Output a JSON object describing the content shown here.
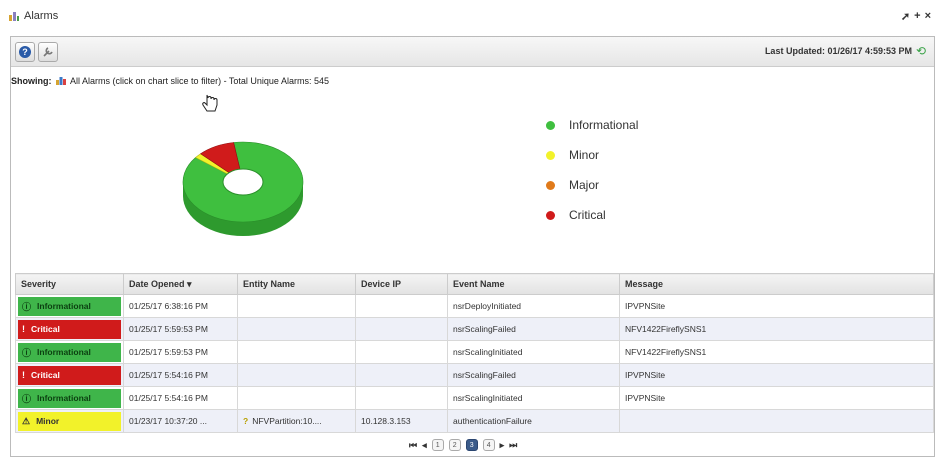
{
  "window": {
    "title": "Alarms",
    "controls": [
      "pin-icon",
      "add-icon",
      "close-icon"
    ]
  },
  "toolbar": {
    "help_icon": "help-icon",
    "settings_icon": "wrench-icon",
    "last_updated": "Last Updated: 01/26/17 4:59:53 PM",
    "refresh_icon": "refresh-icon"
  },
  "showing": {
    "label": "Showing:",
    "text": "All Alarms (click on chart slice to filter) - Total Unique Alarms: 545"
  },
  "chart_data": {
    "type": "pie",
    "categories": [
      "Informational",
      "Minor",
      "Major",
      "Critical"
    ],
    "colors": [
      "#3fbf3f",
      "#f2f22a",
      "#e07a1a",
      "#d01b1b"
    ],
    "values": [
      88,
      2,
      0,
      10
    ],
    "legend_position": "right",
    "donut": true
  },
  "grid": {
    "columns": [
      "Severity",
      "Date Opened",
      "Entity Name",
      "Device IP",
      "Event Name",
      "Message"
    ],
    "sort_indicator": "▾",
    "rows": [
      {
        "severity": "Informational",
        "sev_class": "sev-info",
        "sev_icon": "ⓘ",
        "date": "01/25/17 6:38:16 PM",
        "entity": "",
        "entity_icon": "",
        "ip": "",
        "event": "nsrDeployInitiated",
        "message": "IPVPNSite"
      },
      {
        "severity": "Critical",
        "sev_class": "sev-crit",
        "sev_icon": "!",
        "date": "01/25/17 5:59:53 PM",
        "entity": "",
        "entity_icon": "",
        "ip": "",
        "event": "nsrScalingFailed",
        "message": "NFV1422FireflySNS1"
      },
      {
        "severity": "Informational",
        "sev_class": "sev-info",
        "sev_icon": "ⓘ",
        "date": "01/25/17 5:59:53 PM",
        "entity": "",
        "entity_icon": "",
        "ip": "",
        "event": "nsrScalingInitiated",
        "message": "NFV1422FireflySNS1"
      },
      {
        "severity": "Critical",
        "sev_class": "sev-crit",
        "sev_icon": "!",
        "date": "01/25/17 5:54:16 PM",
        "entity": "",
        "entity_icon": "",
        "ip": "",
        "event": "nsrScalingFailed",
        "message": "IPVPNSite"
      },
      {
        "severity": "Informational",
        "sev_class": "sev-info",
        "sev_icon": "ⓘ",
        "date": "01/25/17 5:54:16 PM",
        "entity": "",
        "entity_icon": "",
        "ip": "",
        "event": "nsrScalingInitiated",
        "message": "IPVPNSite"
      },
      {
        "severity": "Minor",
        "sev_class": "sev-minor",
        "sev_icon": "⚠",
        "date": "01/23/17 10:37:20 ...",
        "entity": "NFVPartition:10....",
        "entity_icon": "?",
        "ip": "10.128.3.153",
        "event": "authenticationFailure",
        "message": ""
      }
    ]
  },
  "pager": {
    "first": "⏮",
    "prev": "◂",
    "pages": [
      "1",
      "2",
      "3",
      "4"
    ],
    "active": "3",
    "next": "▸",
    "last": "⏭"
  }
}
